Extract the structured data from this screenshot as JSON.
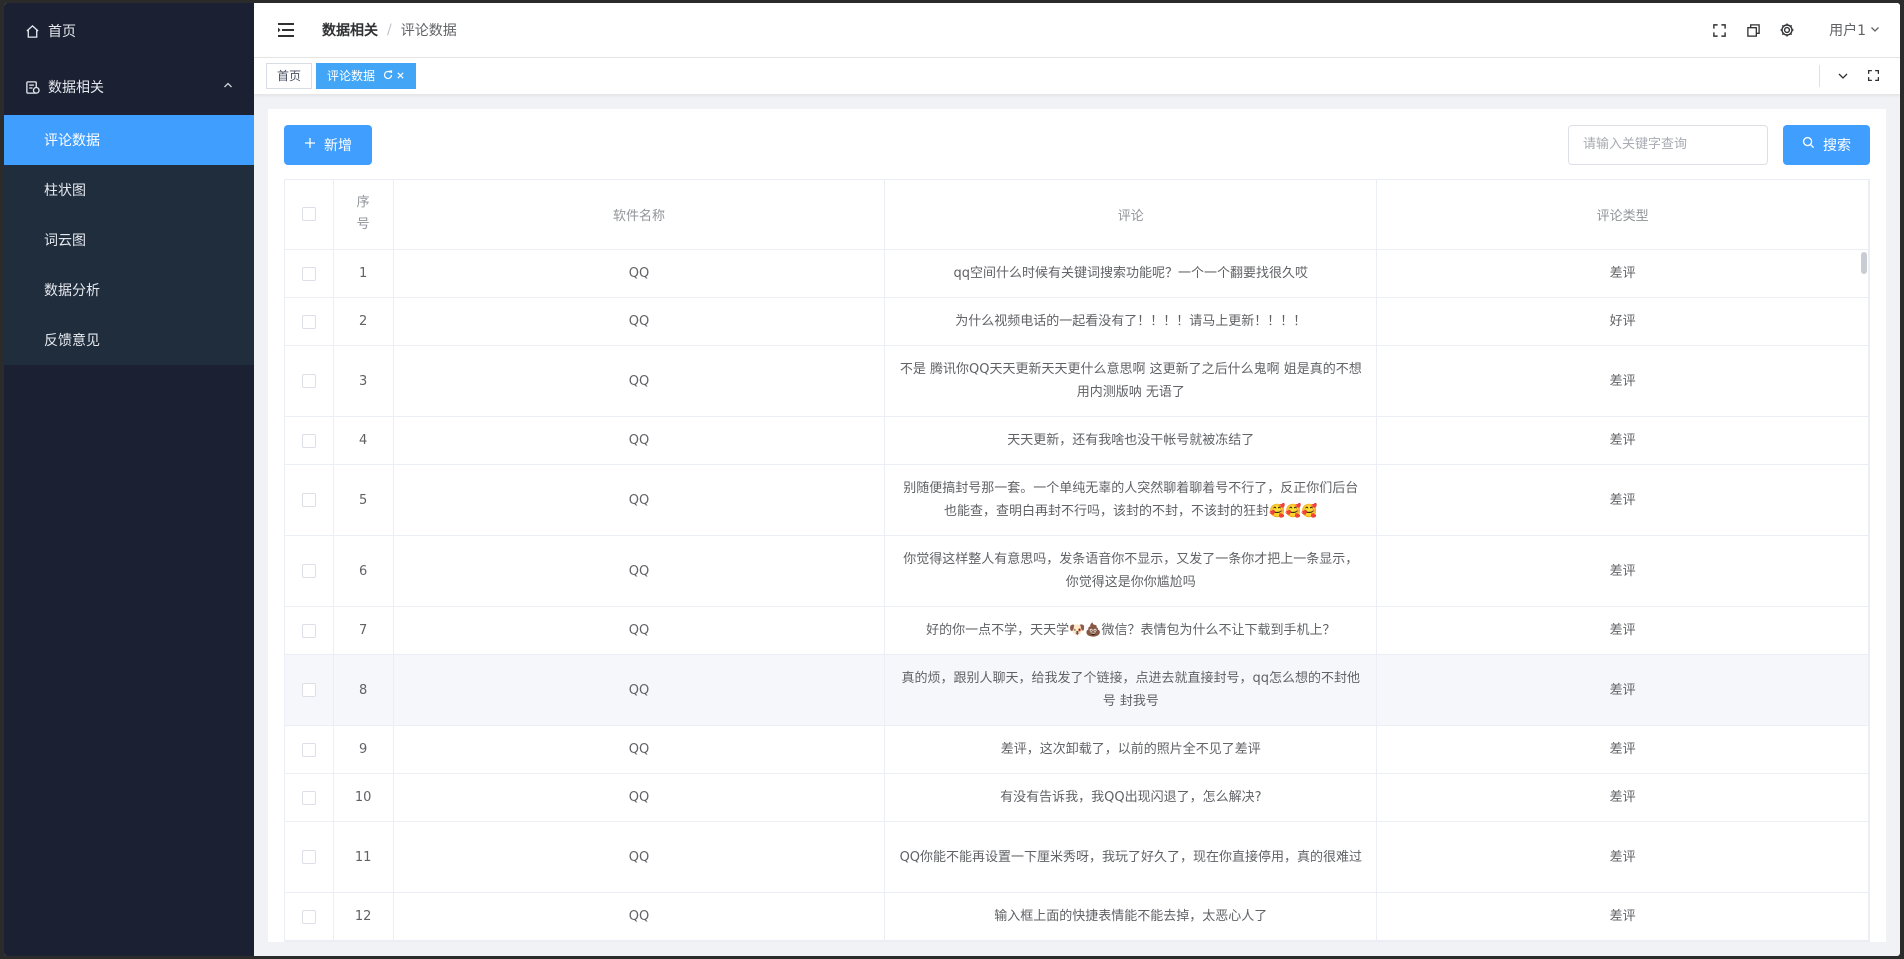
{
  "sidebar": {
    "home_label": "首页",
    "group_label": "数据相关",
    "items": [
      {
        "label": "评论数据",
        "active": true
      },
      {
        "label": "柱状图",
        "active": false
      },
      {
        "label": "词云图",
        "active": false
      },
      {
        "label": "数据分析",
        "active": false
      },
      {
        "label": "反馈意见",
        "active": false
      }
    ]
  },
  "navbar": {
    "breadcrumb_parent": "数据相关",
    "breadcrumb_sep": "/",
    "breadcrumb_current": "评论数据",
    "user_label": "用户1"
  },
  "tags": {
    "home": "首页",
    "current": "评论数据"
  },
  "toolbar": {
    "add_label": "新增",
    "search_placeholder": "请输入关键字查询",
    "search_label": "搜索"
  },
  "table": {
    "headers": {
      "index": "序号",
      "software": "软件名称",
      "comment": "评论",
      "type": "评论类型"
    },
    "rows": [
      {
        "index": "1",
        "software": "QQ",
        "comment": "qq空间什么时候有关键词搜索功能呢？一个一个翻要找很久哎",
        "type": "差评"
      },
      {
        "index": "2",
        "software": "QQ",
        "comment": "为什么视频电话的一起看没有了！！！！请马上更新！！！！",
        "type": "好评"
      },
      {
        "index": "3",
        "software": "QQ",
        "comment": "不是 腾讯你QQ天天更新天天更什么意思啊 这更新了之后什么鬼啊 姐是真的不想用内测版呐 无语了",
        "type": "差评"
      },
      {
        "index": "4",
        "software": "QQ",
        "comment": "天天更新，还有我啥也没干帐号就被冻结了",
        "type": "差评"
      },
      {
        "index": "5",
        "software": "QQ",
        "comment": "别随便搞封号那一套。一个单纯无辜的人突然聊着聊着号不行了，反正你们后台也能查，查明白再封不行吗，该封的不封，不该封的狂封🥰🥰🥰",
        "type": "差评"
      },
      {
        "index": "6",
        "software": "QQ",
        "comment": "你觉得这样整人有意思吗，发条语音你不显示，又发了一条你才把上一条显示，你觉得这是你你尴尬吗",
        "type": "差评"
      },
      {
        "index": "7",
        "software": "QQ",
        "comment": "好的你一点不学，天天学🐶💩微信？表情包为什么不让下载到手机上？",
        "type": "差评"
      },
      {
        "index": "8",
        "software": "QQ",
        "comment": "真的烦，跟别人聊天，给我发了个链接，点进去就直接封号，qq怎么想的不封他号 封我号",
        "type": "差评"
      },
      {
        "index": "9",
        "software": "QQ",
        "comment": "差评，这次卸载了，以前的照片全不见了差评",
        "type": "差评"
      },
      {
        "index": "10",
        "software": "QQ",
        "comment": "有没有告诉我，我QQ出现闪退了，怎么解决?",
        "type": "差评"
      },
      {
        "index": "11",
        "software": "QQ",
        "comment": "QQ你能不能再设置一下厘米秀呀，我玩了好久了，现在你直接停用，真的很难过",
        "type": "差评"
      },
      {
        "index": "12",
        "software": "QQ",
        "comment": "输入框上面的快捷表情能不能去掉，太恶心人了",
        "type": "差评"
      }
    ]
  },
  "colors": {
    "sidebar_bg": "#1b2132",
    "submenu_bg": "#1f2d3d",
    "accent": "#409eff"
  },
  "icons": [
    "home-icon",
    "data-icon",
    "chevron-up-icon",
    "hamburger-icon",
    "fullscreen-icon",
    "copy-icon",
    "gear-icon",
    "chevron-down-icon",
    "refresh-icon",
    "close-icon",
    "plus-icon",
    "search-icon"
  ]
}
